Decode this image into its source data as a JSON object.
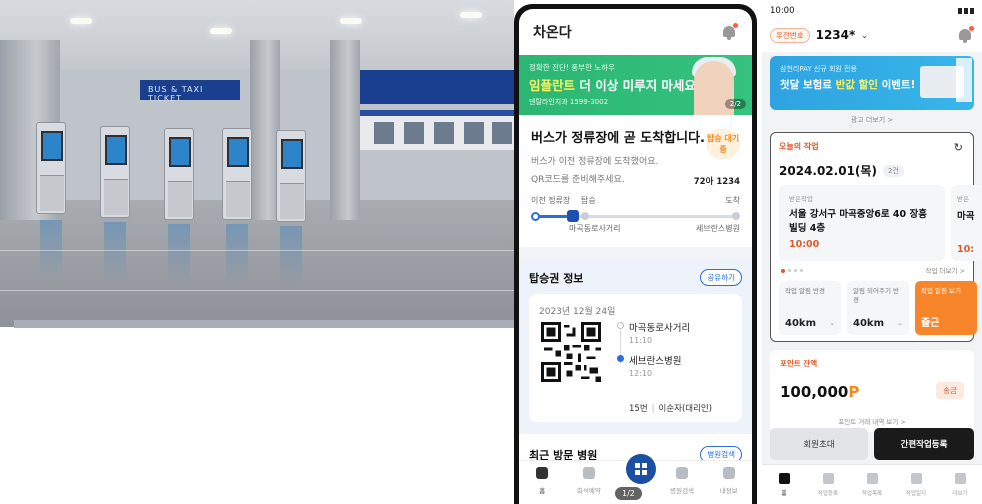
{
  "photo": {
    "sign_text": "BUS & TAXI TICKET"
  },
  "app1": {
    "logo": "차온다",
    "ad": {
      "line1": "정확한 진단! 풍부한 노하우",
      "line2_highlight": "임플란트",
      "line2_rest": " 더 이상 미루지 마세요!",
      "line3": "덴탈라인치과 1599-3002",
      "pager": "2/2"
    },
    "arrival": {
      "title": "버스가 정류장에 곧 도착합니다.",
      "desc1": "버스가 이전 정류장에 도착했어요.",
      "desc2": "QR코드를 준비해주세요.",
      "badge": "탑승 대기중",
      "plate": "72아 1234"
    },
    "route": {
      "prev_label": "이전 정류장",
      "board_label": "탑승",
      "arrive_label": "도착",
      "board_stop": "마곡동로사거리",
      "arrive_stop": "세브란스병원"
    },
    "ticket": {
      "title": "탑승권 정보",
      "share": "공유하기",
      "date": "2023년 12월 24일",
      "stops": [
        {
          "name": "마곡동로사거리",
          "time": "11:10"
        },
        {
          "name": "세브란스병원",
          "time": "12:10"
        }
      ],
      "bus_no": "15번",
      "passenger": "이순자(대리인)"
    },
    "recent": {
      "title": "최근 방문 병원",
      "search": "병원검색"
    },
    "nav": [
      {
        "label": "홈"
      },
      {
        "label": "회석예약"
      },
      {
        "label": ""
      },
      {
        "label": "병원검색"
      },
      {
        "label": "내정보"
      }
    ],
    "page_indicator": "1/2"
  },
  "app2": {
    "status_time": "10:00",
    "tag": "우전번호",
    "number": "1234*",
    "ad": {
      "line1": "삼천리PAY 신규 회원 전용",
      "line2_a": "첫달 보험료 ",
      "line2_highlight": "반값 할인",
      "line2_b": " 이벤트!"
    },
    "more_ad": "광고 더보기 >",
    "work": {
      "title": "오늘의 작업",
      "date": "2024.02.01(목)",
      "count": "2건",
      "job": {
        "label": "받은작업",
        "address": "서울 강서구 마곡중앙6로 40 장흥빌딩 4층",
        "time": "10:00"
      },
      "job2": {
        "label": "받은",
        "address": "마곡",
        "time": "10:"
      },
      "more": "작업 더보기 >",
      "tiles": [
        {
          "label": "작업 알림 반경",
          "value": "40km"
        },
        {
          "label": "알림 되어주기 반경",
          "value": "40km"
        },
        {
          "label": "작업 알림 보기",
          "value": "출근"
        }
      ]
    },
    "point": {
      "label": "포인트 잔액",
      "value": "100,000",
      "unit": "P",
      "button": "송금",
      "history": "포인트 거래 내역 보기 >"
    },
    "actions": {
      "invite": "회원초대",
      "register": "간편작업등록"
    },
    "nav": [
      {
        "label": "홈"
      },
      {
        "label": "작업등록"
      },
      {
        "label": "작업목록"
      },
      {
        "label": "작업일지"
      },
      {
        "label": "더보기"
      }
    ]
  }
}
